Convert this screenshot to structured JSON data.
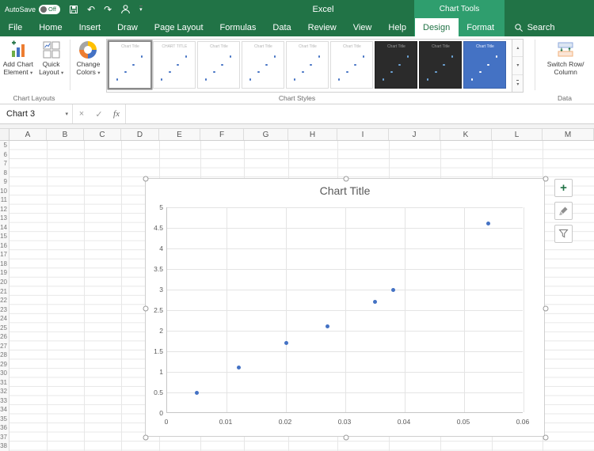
{
  "titlebar": {
    "autosave_label": "AutoSave",
    "autosave_state": "Off",
    "app_title": "Excel",
    "contextual_title": "Chart Tools"
  },
  "tabs": {
    "items": [
      "File",
      "Home",
      "Insert",
      "Draw",
      "Page Layout",
      "Formulas",
      "Data",
      "Review",
      "View",
      "Help",
      "Design",
      "Format"
    ],
    "active": "Design",
    "contextual": [
      "Design",
      "Format"
    ],
    "search_label": "Search"
  },
  "ribbon": {
    "add_chart_element": {
      "line1": "Add Chart",
      "line2": "Element"
    },
    "quick_layout": {
      "line1": "Quick",
      "line2": "Layout"
    },
    "change_colors": {
      "line1": "Change",
      "line2": "Colors"
    },
    "switch_row_column": {
      "line1": "Switch Row/",
      "line2": "Column"
    },
    "group_labels": {
      "chart_layouts": "Chart Layouts",
      "chart_styles": "Chart Styles",
      "data": "Data"
    },
    "style_gallery": [
      {
        "caption": "Chart Title",
        "variant": "light",
        "selected": true
      },
      {
        "caption": "CHART TITLE",
        "variant": "light",
        "selected": false
      },
      {
        "caption": "Chart Title",
        "variant": "light",
        "selected": false
      },
      {
        "caption": "Chart Title",
        "variant": "light",
        "selected": false
      },
      {
        "caption": "Chart Title",
        "variant": "light",
        "selected": false
      },
      {
        "caption": "Chart Title",
        "variant": "light",
        "selected": false
      },
      {
        "caption": "Chart Title",
        "variant": "dark",
        "selected": false
      },
      {
        "caption": "Chart Title",
        "variant": "dark",
        "selected": false
      },
      {
        "caption": "Chart Title",
        "variant": "blue",
        "selected": false
      }
    ]
  },
  "formula_bar": {
    "name_box_value": "Chart 3",
    "fx_label": "fx",
    "formula_value": ""
  },
  "sheet": {
    "column_headers": [
      "A",
      "B",
      "C",
      "D",
      "E",
      "F",
      "G",
      "H",
      "I",
      "J",
      "K",
      "L",
      "M"
    ],
    "rows": [
      5,
      6,
      7,
      8,
      9,
      10,
      11,
      12,
      13,
      14,
      15,
      16,
      17,
      18,
      19,
      20,
      21,
      22,
      23,
      24,
      25,
      26,
      27,
      28,
      29,
      30,
      31,
      32,
      33,
      34,
      35,
      36,
      37,
      38
    ]
  },
  "chart_data": {
    "type": "scatter",
    "title": "Chart Title",
    "x": [
      0.005,
      0.012,
      0.02,
      0.027,
      0.035,
      0.038,
      0.054
    ],
    "y": [
      0.5,
      1.1,
      1.7,
      2.1,
      2.7,
      3.0,
      4.6
    ],
    "xlim": [
      0,
      0.06
    ],
    "ylim": [
      0,
      5
    ],
    "x_ticks": [
      "0",
      "0.01",
      "0.02",
      "0.03",
      "0.04",
      "0.05",
      "0.06"
    ],
    "y_ticks": [
      "0",
      "0.5",
      "1",
      "1.5",
      "2",
      "2.5",
      "3",
      "3.5",
      "4",
      "4.5",
      "5"
    ],
    "grid": true,
    "legend": "none",
    "marker_color": "#4472c4"
  },
  "colors": {
    "ribbon_green": "#217346",
    "contextual_green": "#2f9e6e",
    "marker_blue": "#4472c4"
  }
}
